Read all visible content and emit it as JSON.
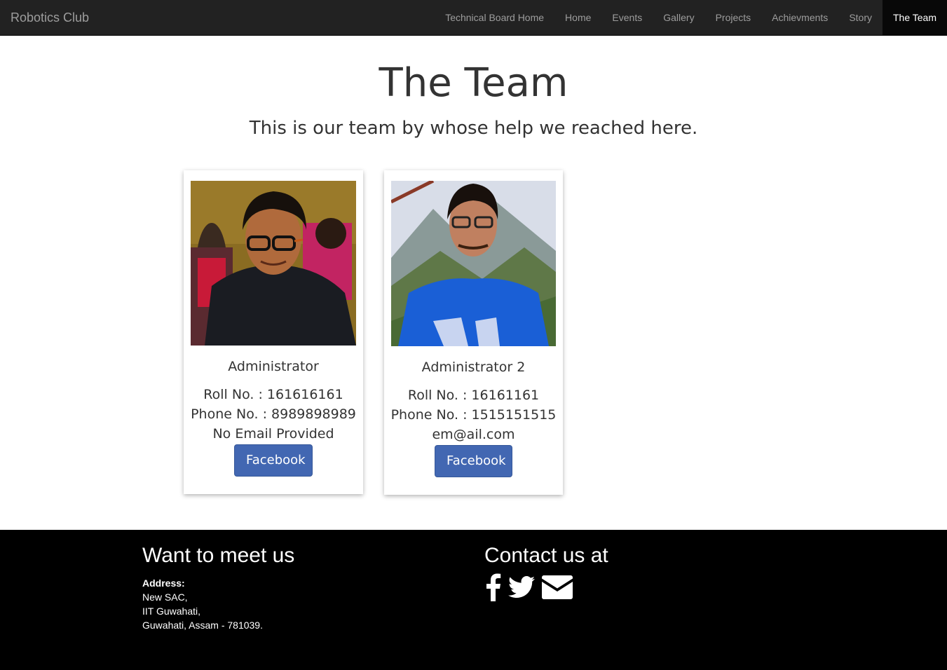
{
  "navbar": {
    "brand": "Robotics Club",
    "items": [
      {
        "label": "Technical Board Home",
        "active": false
      },
      {
        "label": "Home",
        "active": false
      },
      {
        "label": "Events",
        "active": false
      },
      {
        "label": "Gallery",
        "active": false
      },
      {
        "label": "Projects",
        "active": false
      },
      {
        "label": "Achievments",
        "active": false
      },
      {
        "label": "Story",
        "active": false
      },
      {
        "label": "The Team",
        "active": true
      }
    ]
  },
  "header": {
    "title": "The Team",
    "subtitle": "This is our team by whose help we reached here."
  },
  "members": [
    {
      "role": "Administrator",
      "roll": "Roll No. : 161616161",
      "phone": "Phone No. : 8989898989",
      "email": "No Email Provided",
      "button": "Facebook"
    },
    {
      "role": "Administrator 2",
      "roll": "Roll No. : 16161161",
      "phone": "Phone No. : 1515151515",
      "email": "em@ail.com",
      "button": "Facebook"
    }
  ],
  "footer": {
    "meet_title": "Want to meet us",
    "address_label": "Address:",
    "address_lines": [
      "New SAC,",
      "IIT Guwahati,",
      "Guwahati, Assam - 781039."
    ],
    "contact_title": "Contact us at",
    "social_icons": [
      "facebook-icon",
      "twitter-icon",
      "envelope-icon"
    ]
  },
  "colors": {
    "navbar_bg": "#222222",
    "navbar_text": "#9d9d9d",
    "navbar_active_bg": "#080808",
    "facebook_button": "#4267b2",
    "footer_bg": "#000000"
  }
}
